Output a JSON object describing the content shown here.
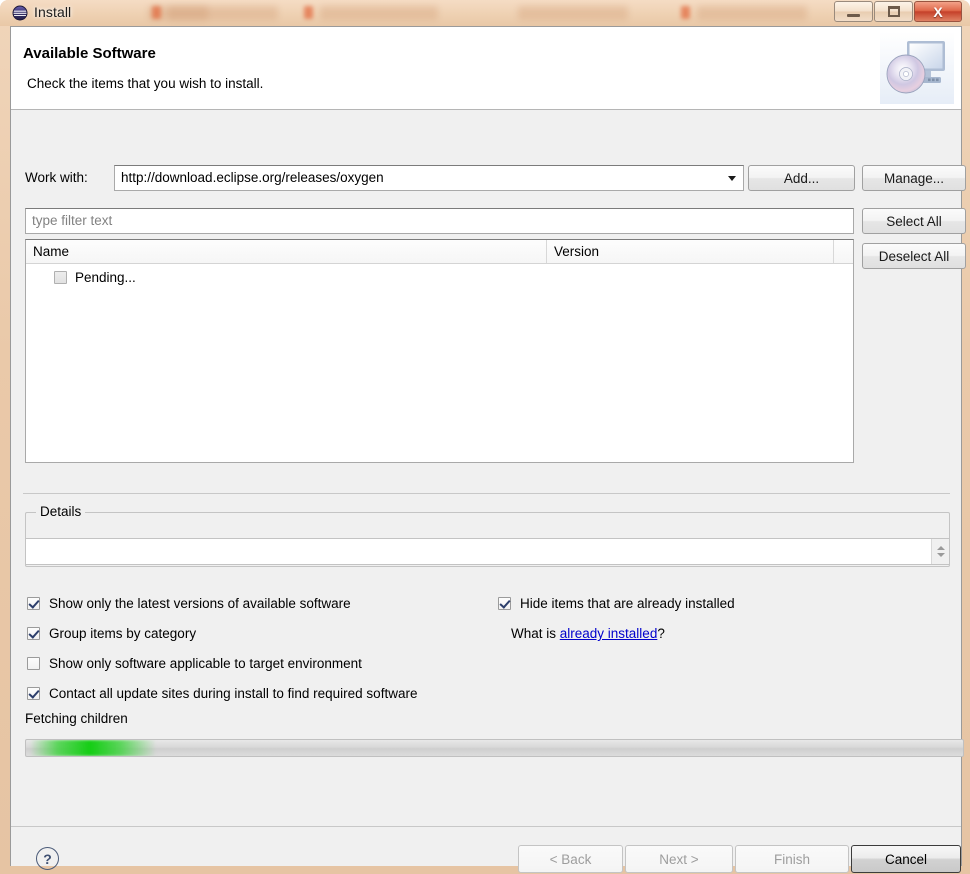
{
  "window": {
    "title": "Install",
    "title_icon": "eclipse-globe-icon",
    "controls": {
      "minimize": "minimize-icon",
      "maximize": "restore-icon",
      "close": "X"
    }
  },
  "banner": {
    "title": "Available Software",
    "subtitle": "Check the items that you wish to install.",
    "icon": "computer-disc-icon"
  },
  "work_with": {
    "label": "Work with:",
    "value": "http://download.eclipse.org/releases/oxygen",
    "add_label": "Add...",
    "manage_label": "Manage..."
  },
  "filter": {
    "placeholder": "type filter text",
    "value": ""
  },
  "table": {
    "columns": [
      "Name",
      "Version"
    ],
    "rows": [
      {
        "name": "Pending...",
        "version": "",
        "checked": false,
        "enabled": false
      }
    ]
  },
  "side_buttons": {
    "select_all": "Select All",
    "deselect_all": "Deselect All"
  },
  "details": {
    "legend": "Details",
    "text": ""
  },
  "options": {
    "show_latest": {
      "label": "Show only the latest versions of available software",
      "checked": true
    },
    "group_by_category": {
      "label": "Group items by category",
      "checked": true
    },
    "applicable_target": {
      "label": "Show only software applicable to target environment",
      "checked": false
    },
    "contact_all_sites": {
      "label": "Contact all update sites during install to find required software",
      "checked": true
    },
    "hide_installed": {
      "label": "Hide items that are already installed",
      "checked": true
    }
  },
  "what_is": {
    "prefix": "What is ",
    "link": "already installed",
    "suffix": "?"
  },
  "progress": {
    "status": "Fetching children",
    "indeterminate": true,
    "accent_color": "#14cd14"
  },
  "footer": {
    "help": "?",
    "back": "< Back",
    "next": "Next >",
    "finish": "Finish",
    "cancel": "Cancel"
  }
}
